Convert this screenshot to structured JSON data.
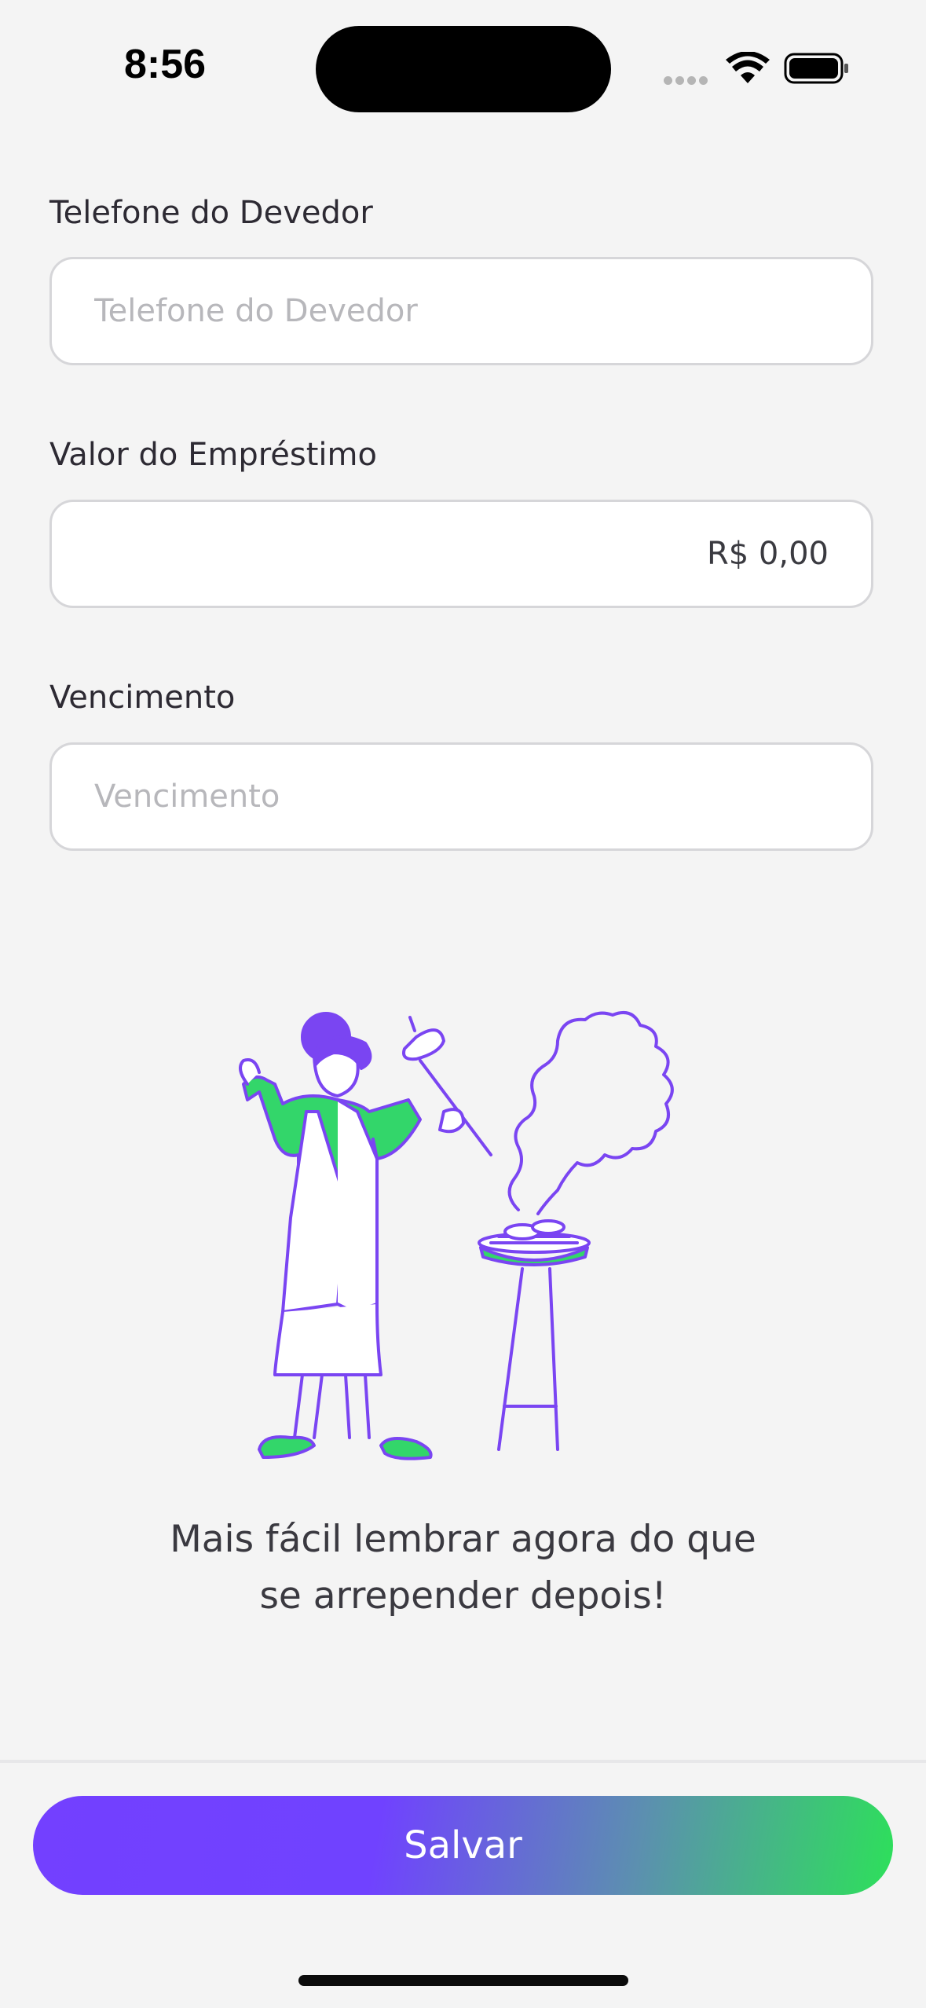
{
  "status_bar": {
    "time": "8:56"
  },
  "form": {
    "phone": {
      "label": "Telefone do Devedor",
      "placeholder": "Telefone do Devedor",
      "value": ""
    },
    "amount": {
      "label": "Valor do Empréstimo",
      "placeholder": "",
      "value": "R$ 0,00"
    },
    "due_date": {
      "label": "Vencimento",
      "placeholder": "Vencimento",
      "value": ""
    }
  },
  "tagline": {
    "line1": "Mais fácil lembrar agora do que",
    "line2": "se arrepender depois!"
  },
  "footer": {
    "save_label": "Salvar"
  },
  "colors": {
    "accent_purple": "#7340ff",
    "accent_green": "#2de05a",
    "illustration_green": "#33d66a"
  },
  "icons": [
    "signal-icon",
    "wifi-icon",
    "battery-icon",
    "barbecue-illustration"
  ]
}
